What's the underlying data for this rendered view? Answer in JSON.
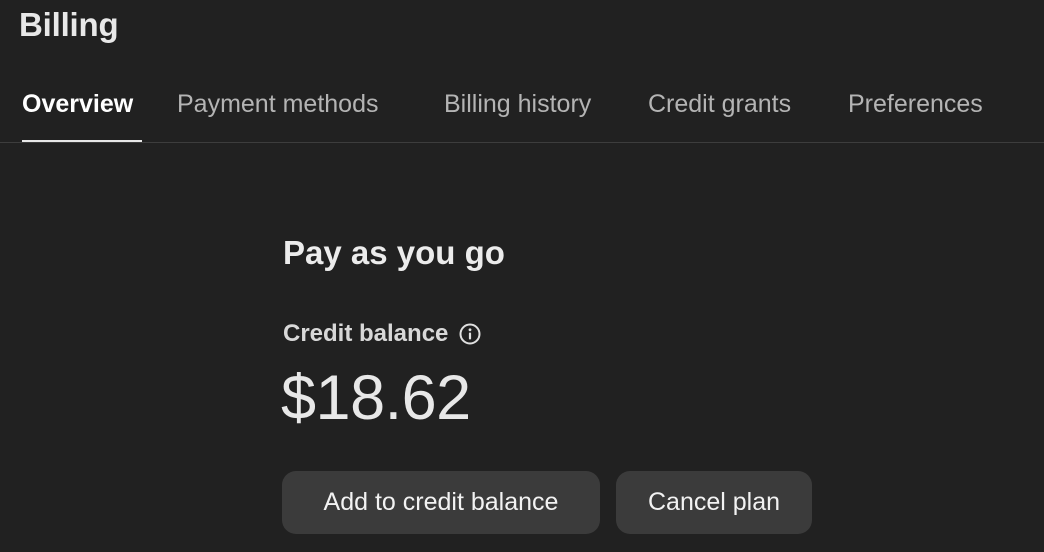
{
  "header": {
    "title": "Billing"
  },
  "tabs": [
    {
      "label": "Overview",
      "active": true
    },
    {
      "label": "Payment methods",
      "active": false
    },
    {
      "label": "Billing history",
      "active": false
    },
    {
      "label": "Credit grants",
      "active": false
    },
    {
      "label": "Preferences",
      "active": false
    }
  ],
  "plan": {
    "title": "Pay as you go",
    "credit_label": "Credit balance",
    "credit_info_icon": "info-circle-icon",
    "credit_value": "$18.62"
  },
  "actions": {
    "add_credit_label": "Add to credit balance",
    "cancel_plan_label": "Cancel plan"
  },
  "colors": {
    "background": "#212121",
    "button_bg": "#3b3b3b",
    "active_tab": "#ffffff",
    "inactive_tab": "#b4b4b4"
  }
}
